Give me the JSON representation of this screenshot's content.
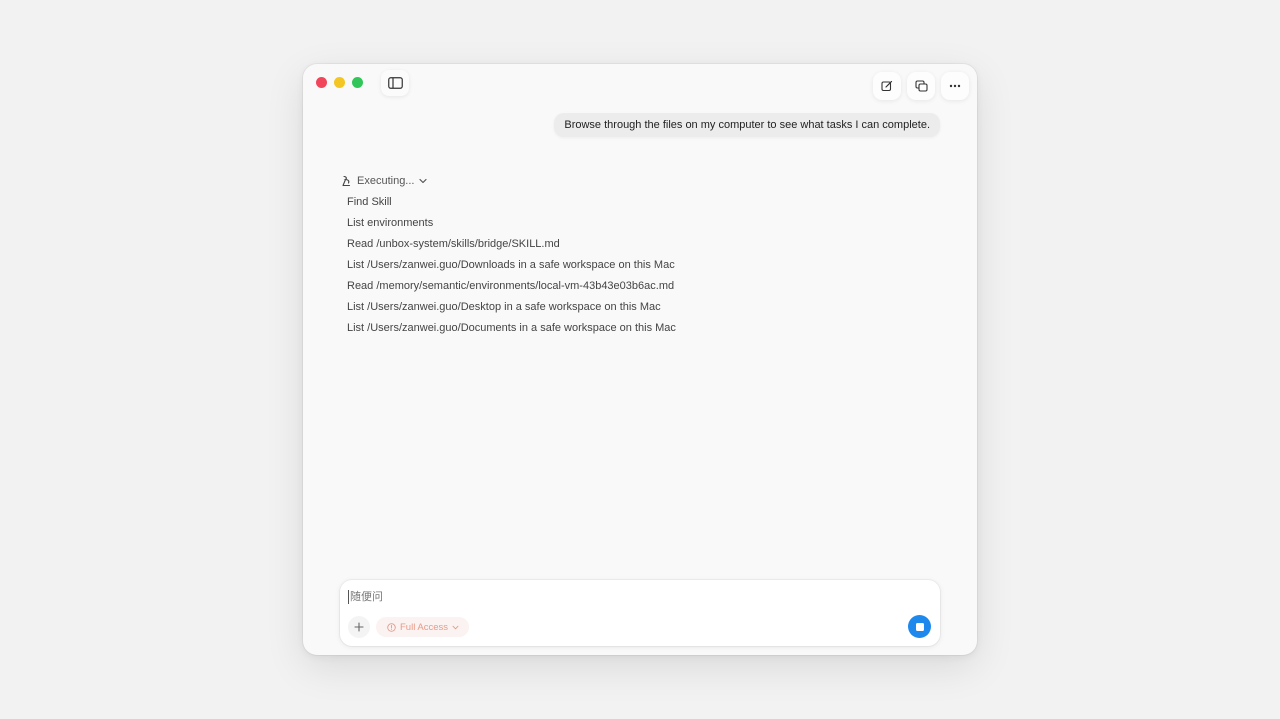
{
  "window": {
    "traffic_lights": [
      "close",
      "minimize",
      "zoom"
    ],
    "colors": {
      "close": "#f0455a",
      "minimize": "#f3c623",
      "zoom": "#32c65a"
    }
  },
  "toolbar": {
    "sidebar_icon": "sidebar-icon",
    "actions": [
      "new-chat-icon",
      "windows-icon",
      "more-icon"
    ]
  },
  "conversation": {
    "user_message": "Browse through the files on my computer to see what tasks I can complete.",
    "status": {
      "label": "Executing...",
      "icon": "skill-icon",
      "chevron": "chevron-down-icon"
    },
    "steps": [
      "Find Skill",
      "List environments",
      "Read /unbox-system/skills/bridge/SKILL.md",
      "List /Users/zanwei.guo/Downloads in a safe workspace on this Mac",
      "Read /memory/semantic/environments/local-vm-43b43e03b6ac.md",
      "List /Users/zanwei.guo/Desktop in a safe workspace on this Mac",
      "List /Users/zanwei.guo/Documents in a safe workspace on this Mac"
    ]
  },
  "composer": {
    "placeholder": "随便问",
    "access_label": "Full Access",
    "access_color": "#e99a88",
    "send_color": "#1f88ec"
  }
}
